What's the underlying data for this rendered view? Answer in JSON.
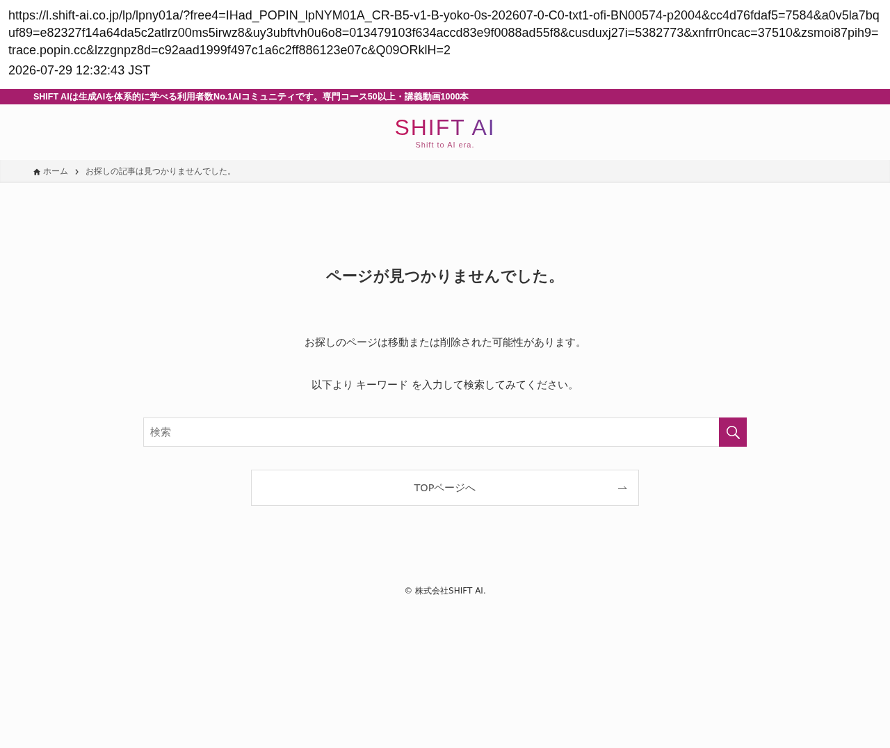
{
  "capture": {
    "url": "https://l.shift-ai.co.jp/lp/lpny01a/?free4=IHad_POPIN_lpNYM01A_CR-B5-v1-B-yoko-0s-202607-0-C0-txt1-ofi-BN00574-p2004&cc4d76fdaf5=7584&a0v5la7bquf89=e82327f14a64da5c2atlrz00ms5irwz8&uy3ubftvh0u6o8=013479103f634accd83e9f0088ad55f8&cusduxj27i=5382773&xnfrr0ncac=37510&zsmoi87pih9=trace.popin.cc&lzzgnpz8d=c92aad1999f497c1a6c2ff886123e07c&Q09ORklH=2",
    "timestamp": "2026-07-29 12:32:43 JST"
  },
  "announcement_bar": {
    "text": "SHIFT AIは生成AIを体系的に学べる利用者数No.1AIコミュニティです。専門コース50以上・講義動画1000本"
  },
  "header": {
    "logo": "SHIFT AI",
    "tagline": "Shift to AI era."
  },
  "breadcrumb": [
    {
      "kind": "home",
      "label": "ホーム"
    },
    {
      "kind": "current",
      "label": "お探しの記事は見つかりませんでした。"
    }
  ],
  "main": {
    "title": "ページが見つかりませんでした。",
    "paragraphs": [
      "お探しのページは移動または削除された可能性があります。",
      "以下より キーワード を入力して検索してみてください。"
    ],
    "search": {
      "placeholder": "検索"
    },
    "top_button": {
      "label": "TOPページへ"
    }
  },
  "footer": {
    "copyright": "© 株式会社SHIFT AI."
  }
}
